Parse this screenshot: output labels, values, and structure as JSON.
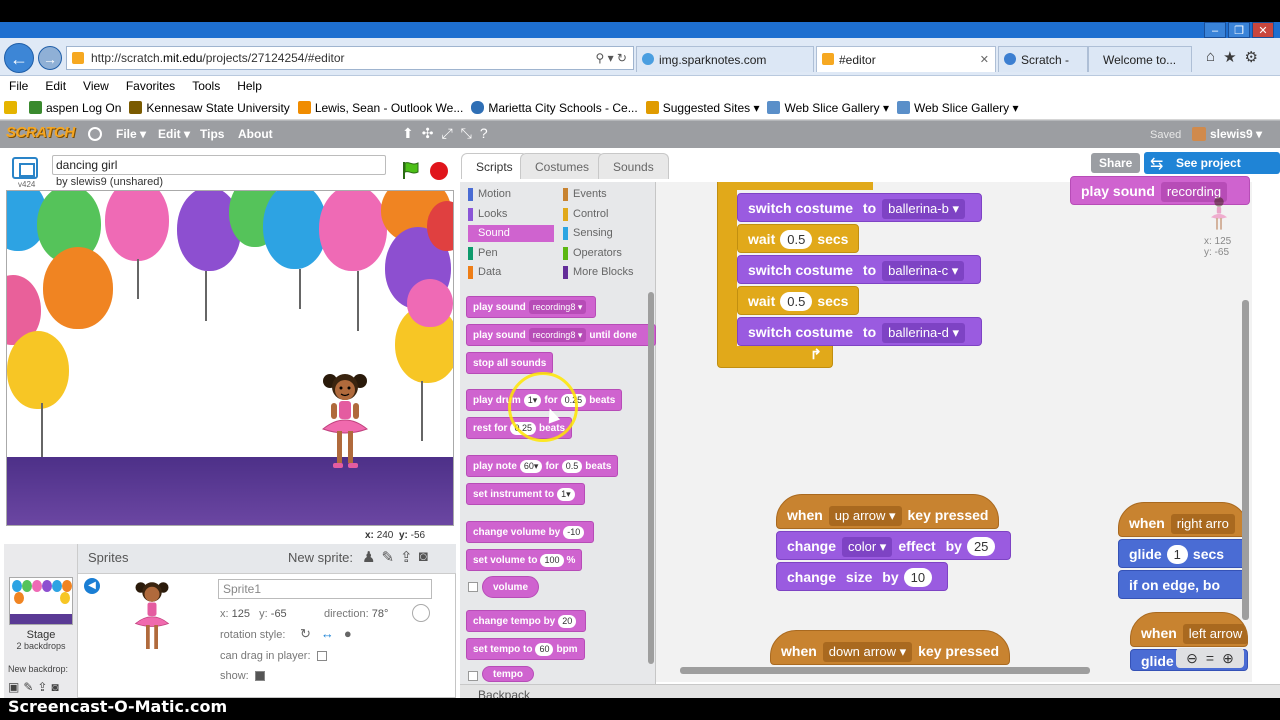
{
  "browser": {
    "url_prefix": "http://scratch.",
    "url_domain": "mit.edu",
    "url_suffix": "/projects/27124254/#editor",
    "tabs": [
      {
        "label": "img.sparknotes.com",
        "active": false
      },
      {
        "label": "#editor",
        "active": true
      },
      {
        "label": "Scratch -",
        "active": false
      },
      {
        "label": "Welcome to...",
        "active": false
      }
    ],
    "menu": [
      "File",
      "Edit",
      "View",
      "Favorites",
      "Tools",
      "Help"
    ],
    "favorites": [
      "aspen Log On",
      "Kennesaw State University",
      "Lewis, Sean - Outlook We...",
      "Marietta City Schools - Ce...",
      "Suggested Sites ▾",
      "Web Slice Gallery ▾",
      "Web Slice Gallery ▾"
    ]
  },
  "scratch_bar": {
    "logo": "SCRATCH",
    "file": "File ▾",
    "edit": "Edit ▾",
    "tips": "Tips",
    "about": "About",
    "saved": "Saved",
    "user": "slewis9 ▾"
  },
  "stage": {
    "version": "v424",
    "title": "dancing girl",
    "byline": "by slewis9 (unshared)",
    "x_label": "x:",
    "x": "240",
    "y_label": "y:",
    "y": "-56"
  },
  "sprites": {
    "label": "Sprites",
    "new_sprite": "New sprite:",
    "stage_label": "Stage",
    "backdrops": "2 backdrops",
    "new_backdrop": "New backdrop:",
    "sprite_name_placeholder": "Sprite1",
    "x_label": "x:",
    "x": "125",
    "y_label": "y:",
    "y": "-65",
    "direction_label": "direction:",
    "direction": "78°",
    "rotation_label": "rotation style:",
    "drag_label": "can drag in player:",
    "show_label": "show:"
  },
  "editor_tabs": [
    "Scripts",
    "Costumes",
    "Sounds"
  ],
  "share": "Share",
  "see_project": "See project page",
  "categories": {
    "left": [
      "Motion",
      "Looks",
      "Sound",
      "Pen",
      "Data"
    ],
    "right": [
      "Events",
      "Control",
      "Sensing",
      "Operators",
      "More Blocks"
    ],
    "left_colors": [
      "#4a6cd4",
      "#8a55d7",
      "#cf63cf",
      "#0e9a6c",
      "#ee7d16"
    ],
    "right_colors": [
      "#c88330",
      "#e1a91a",
      "#2ca5e2",
      "#5cb712",
      "#632d99"
    ],
    "selected": "Sound"
  },
  "palette": {
    "play_sound": "play sound",
    "play_sound_until": "play sound",
    "until_done": "until done",
    "recording": "recording8 ▾",
    "stop_all": "stop all sounds",
    "play_drum": "play drum",
    "drum_val": "1▾",
    "for": "for",
    "beats_val": "0.25",
    "beats": "beats",
    "rest_for": "rest for",
    "rest_val": "0.25",
    "play_note": "play note",
    "note_val": "60▾",
    "note_beats": "0.5",
    "set_instrument": "set instrument to",
    "instrument_val": "1▾",
    "change_volume": "change volume by",
    "volume_delta": "-10",
    "set_volume": "set volume to",
    "volume_val": "100",
    "percent": "%",
    "volume_rep": "volume",
    "change_tempo": "change tempo by",
    "tempo_delta": "20",
    "set_tempo": "set tempo to",
    "tempo_val": "60",
    "bpm": "bpm",
    "tempo_rep": "tempo"
  },
  "scripts": {
    "switch_costume": "switch costume",
    "to": "to",
    "costume_b": "ballerina-b ▾",
    "costume_c": "ballerina-c ▾",
    "costume_d": "ballerina-d ▾",
    "wait": "wait",
    "wait_val": "0.5",
    "secs": "secs",
    "play_sound": "play sound",
    "recording": "recording",
    "sprite_x": "x: 125",
    "sprite_y": "y: -65",
    "when": "when",
    "key_pressed": "key pressed",
    "up_arrow": "up arrow ▾",
    "down_arrow": "down arrow ▾",
    "right_arrow": "right arro",
    "left_arrow": "left arrow",
    "change": "change",
    "color": "color ▾",
    "effect_by": "effect",
    "by": "by",
    "effect_val": "25",
    "size": "size",
    "size_val": "10",
    "glide": "glide",
    "glide_val": "1",
    "glide_secs": "secs",
    "if_on_edge": "if on edge, bo",
    "glide_partial": "glide"
  },
  "backpack": "Backpack",
  "watermark": "Screencast-O-Matic.com"
}
